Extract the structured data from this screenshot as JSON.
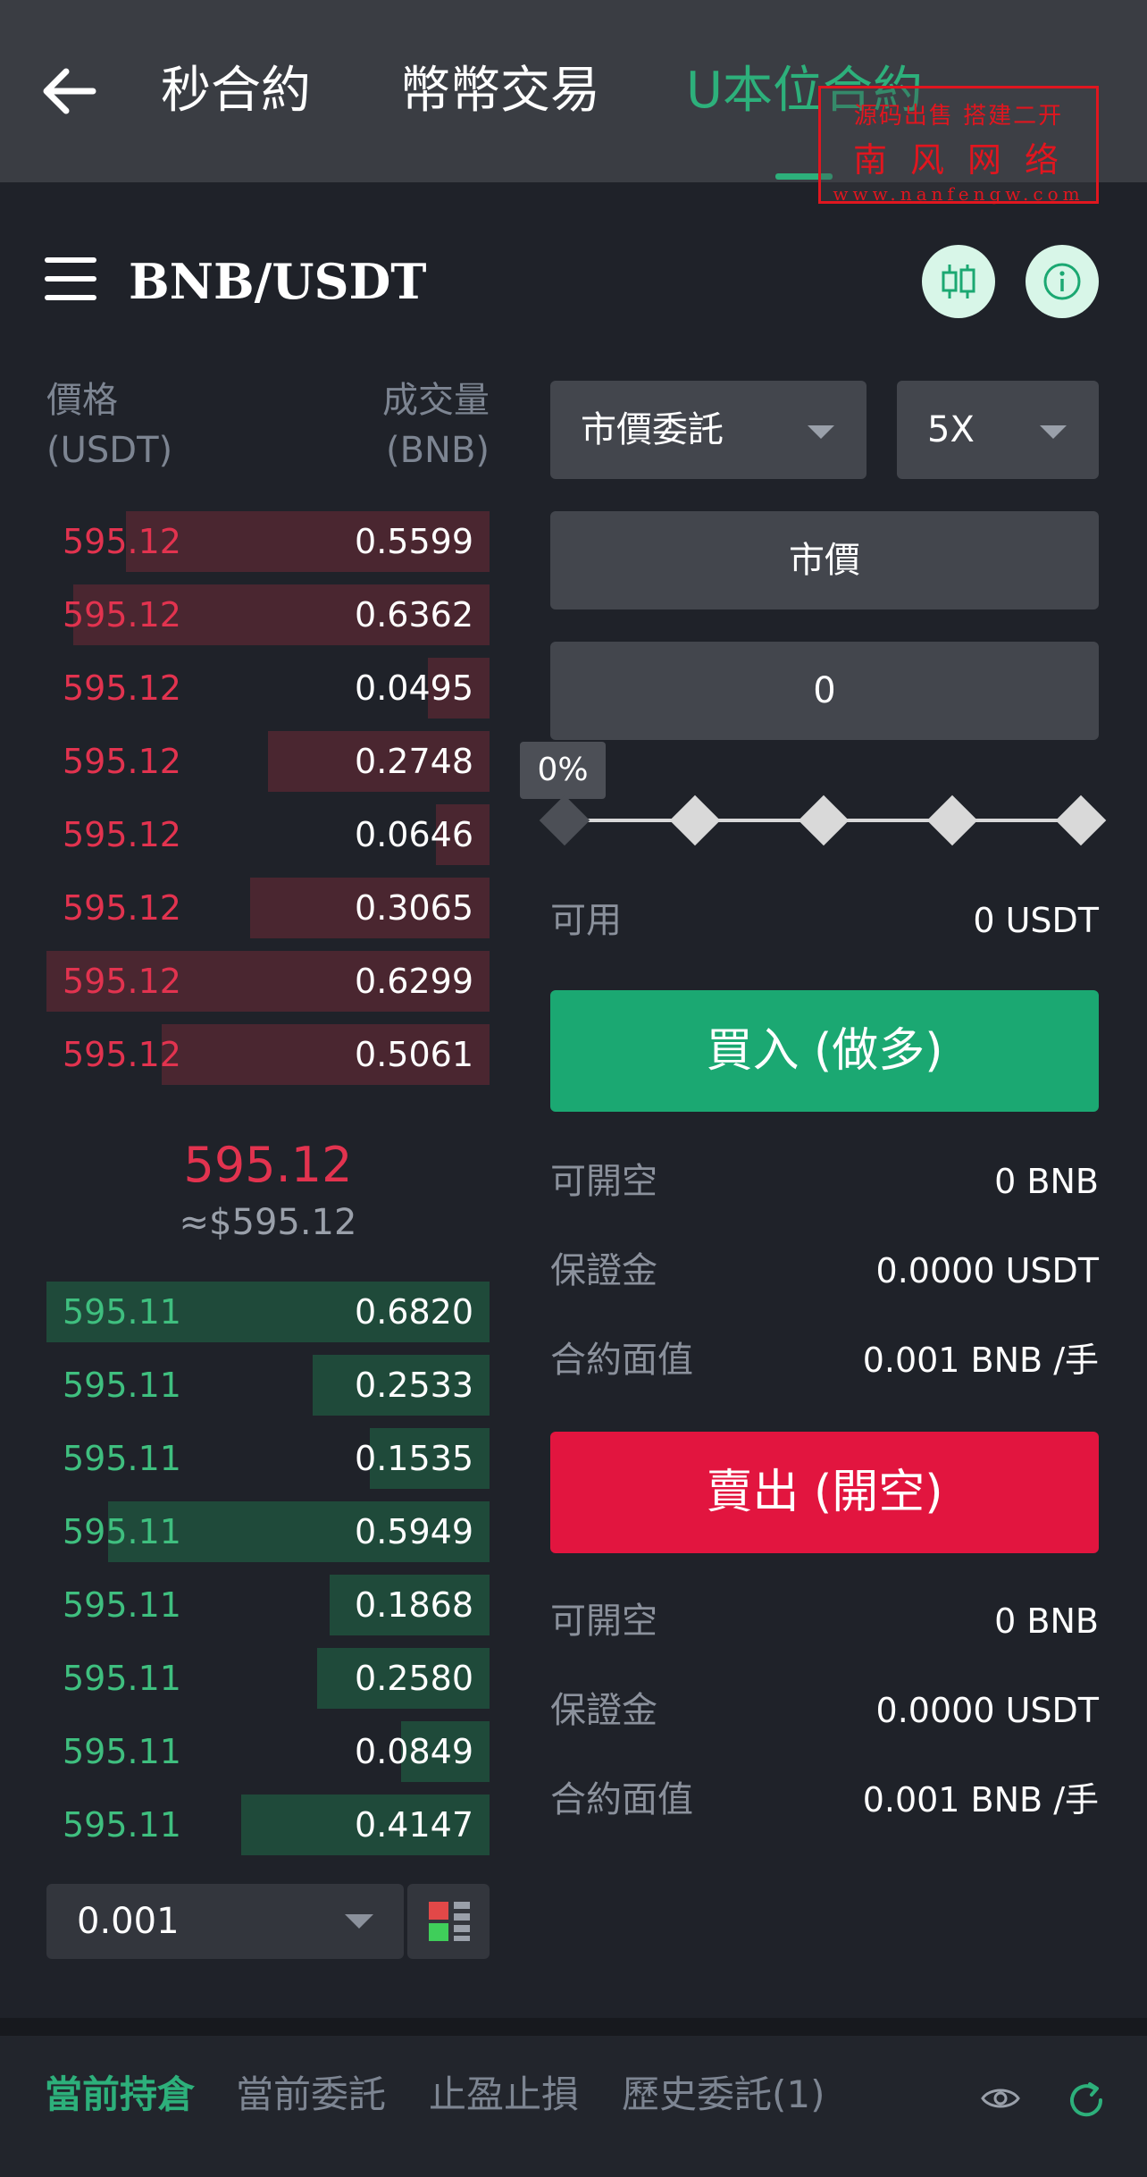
{
  "topnav": {
    "tabs": [
      {
        "label": "秒合約"
      },
      {
        "label": "幣幣交易"
      },
      {
        "label": "U本位合約"
      }
    ],
    "active_tab": 2,
    "accent_color": "#2db07b"
  },
  "watermark": {
    "line1": "源码出售 搭建二开",
    "line2": "南风网络",
    "line3": "www.nanfengw.com"
  },
  "header": {
    "pair": "BNB/USDT"
  },
  "orderbook": {
    "price_header": "價格",
    "price_unit": "(USDT)",
    "volume_header": "成交量",
    "volume_unit": "(BNB)",
    "asks": [
      {
        "price": "595.12",
        "volume": "0.5599",
        "depth": 0.82
      },
      {
        "price": "595.12",
        "volume": "0.6362",
        "depth": 0.94
      },
      {
        "price": "595.12",
        "volume": "0.0495",
        "depth": 0.14
      },
      {
        "price": "595.12",
        "volume": "0.2748",
        "depth": 0.5
      },
      {
        "price": "595.12",
        "volume": "0.0646",
        "depth": 0.12
      },
      {
        "price": "595.12",
        "volume": "0.3065",
        "depth": 0.54
      },
      {
        "price": "595.12",
        "volume": "0.6299",
        "depth": 1.0
      },
      {
        "price": "595.12",
        "volume": "0.5061",
        "depth": 0.74
      }
    ],
    "mid_price": "595.12",
    "mid_usd": "≈$595.12",
    "bids": [
      {
        "price": "595.11",
        "volume": "0.6820",
        "depth": 1.0
      },
      {
        "price": "595.11",
        "volume": "0.2533",
        "depth": 0.4
      },
      {
        "price": "595.11",
        "volume": "0.1535",
        "depth": 0.27
      },
      {
        "price": "595.11",
        "volume": "0.5949",
        "depth": 0.86
      },
      {
        "price": "595.11",
        "volume": "0.1868",
        "depth": 0.36
      },
      {
        "price": "595.11",
        "volume": "0.2580",
        "depth": 0.39
      },
      {
        "price": "595.11",
        "volume": "0.0849",
        "depth": 0.2
      },
      {
        "price": "595.11",
        "volume": "0.4147",
        "depth": 0.56
      }
    ],
    "depth_step": "0.001"
  },
  "form": {
    "order_type": "市價委託",
    "leverage": "5X",
    "price_field": "市價",
    "amount_value": "0",
    "slider_percent": "0%",
    "slider_level": 0,
    "available_label": "可用",
    "available_value": "0 USDT",
    "buy_label": "買入 (做多)",
    "buy_info": [
      {
        "label": "可開空",
        "value": "0 BNB"
      },
      {
        "label": "保證金",
        "value": "0.0000 USDT"
      },
      {
        "label": "合約面值",
        "value": "0.001 BNB /手"
      }
    ],
    "sell_label": "賣出 (開空)",
    "sell_info": [
      {
        "label": "可開空",
        "value": "0 BNB"
      },
      {
        "label": "保證金",
        "value": "0.0000 USDT"
      },
      {
        "label": "合約面值",
        "value": "0.001 BNB /手"
      }
    ],
    "buy_color": "#1ba872",
    "sell_color": "#e2153f"
  },
  "bottom_tabs": [
    {
      "label": "當前持倉"
    },
    {
      "label": "當前委託"
    },
    {
      "label": "止盈止損"
    },
    {
      "label": "歷史委託(1)"
    }
  ],
  "icons": {
    "back": "arrow-left-icon",
    "menu": "hamburger-menu-icon",
    "chart": "candlestick-chart-icon",
    "info": "info-icon",
    "depth_layout": "orderbook-layout-icon",
    "eye": "eye-icon",
    "refresh": "refresh-icon"
  }
}
